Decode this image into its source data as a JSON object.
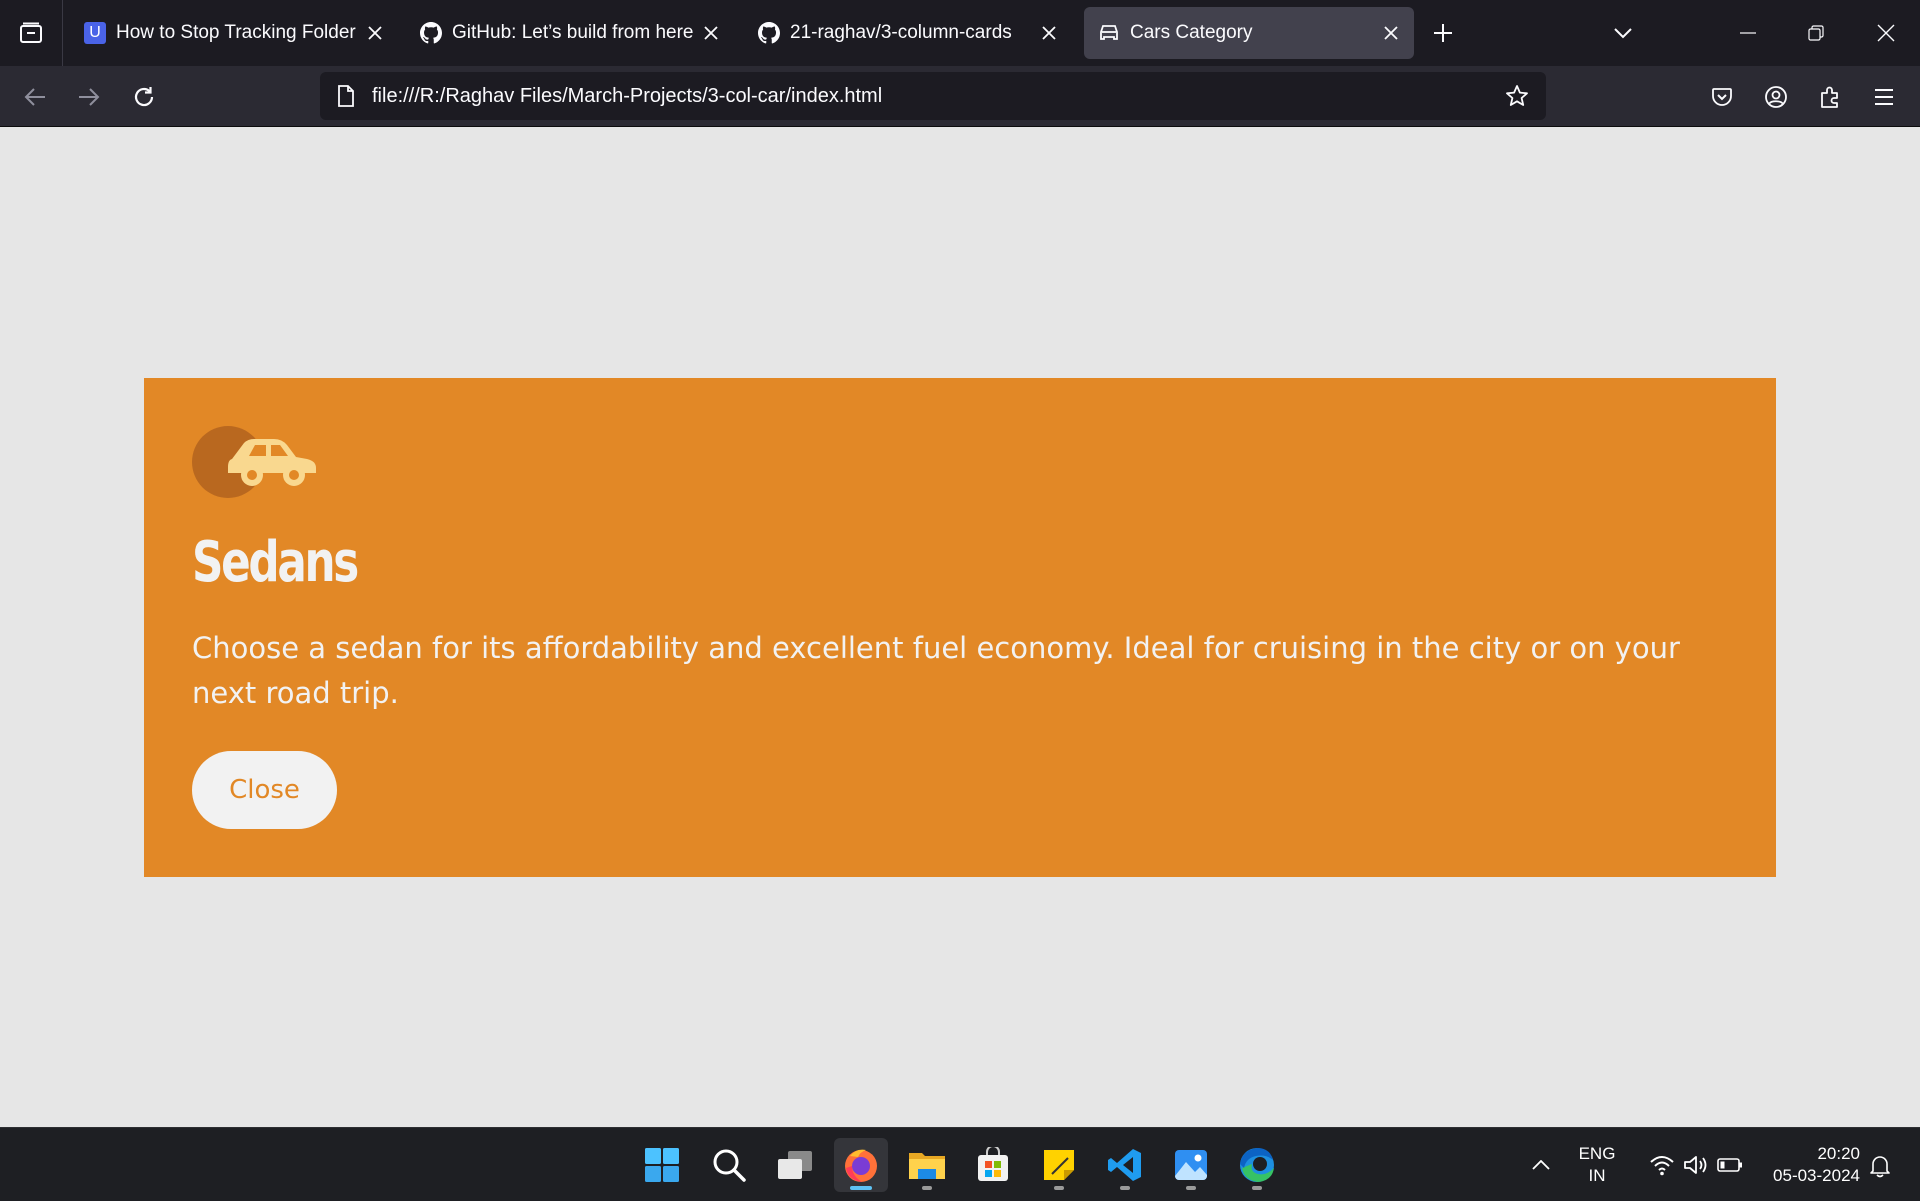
{
  "browser": {
    "tabs": [
      {
        "title": "How to Stop Tracking Folder in",
        "favicon": "u-letter-icon",
        "favicon_letter": "U",
        "active": false
      },
      {
        "title": "GitHub: Let’s build from here · G",
        "favicon": "github-icon",
        "active": false
      },
      {
        "title": "21-raghav/3-column-cards",
        "favicon": "github-icon",
        "active": false
      },
      {
        "title": "Cars Category",
        "favicon": "car-icon",
        "active": true
      }
    ],
    "url": "file:///R:/Raghav Files/March-Projects/3-col-car/index.html"
  },
  "card": {
    "color": "#e28826",
    "icon": "sedan-car-icon",
    "title": "Sedans",
    "text": "Choose a sedan for its affordability and excellent fuel economy. Ideal for cruising in the city or on your next road trip.",
    "button_label": "Close"
  },
  "taskbar": {
    "apps": [
      "start-icon",
      "search-icon",
      "task-view-icon",
      "firefox-icon",
      "file-explorer-icon",
      "microsoft-store-icon",
      "sticky-notes-icon",
      "vscode-icon",
      "photos-icon",
      "edge-icon"
    ],
    "language_line1": "ENG",
    "language_line2": "IN",
    "time": "20:20",
    "date": "05-03-2024"
  }
}
